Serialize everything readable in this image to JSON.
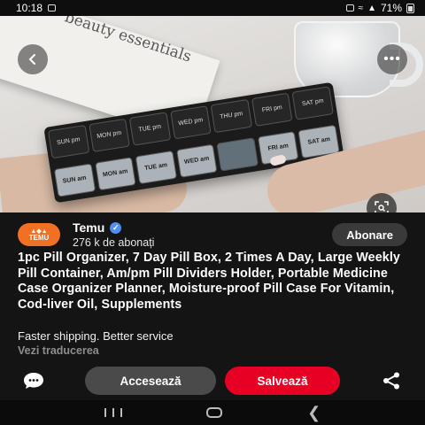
{
  "status_bar": {
    "time": "10:18",
    "battery": "71%"
  },
  "image": {
    "book_text": "beauty essentials",
    "organizer": {
      "pm_labels": [
        "SUN pm",
        "MON pm",
        "TUE pm",
        "WED pm",
        "THU pm",
        "FRI pm",
        "SAT pm"
      ],
      "am_labels": [
        "SUN am",
        "MON am",
        "TUE am",
        "WED am",
        "",
        "FRI am",
        "SAT am"
      ]
    }
  },
  "creator": {
    "avatar_text": "TEMU",
    "name": "Temu",
    "followers": "276 k de abonați",
    "subscribe_label": "Abonare"
  },
  "pin": {
    "title": "1pc Pill Organizer, 7 Day Pill Box, 2 Times A Day, Large Weekly Pill Container, Am/pm Pill Dividers Holder, Portable Medicine Case Organizer Planner, Moisture-proof Pill Case For Vitamin, Cod-liver Oil, Supplements",
    "subtitle": "Faster shipping. Better service",
    "translate_label": "Vezi traducerea"
  },
  "actions": {
    "access_label": "Accesează",
    "save_label": "Salvează"
  },
  "colors": {
    "save_red": "#e60023",
    "temu_orange": "#f36f21",
    "verified_blue": "#4e8ff7"
  },
  "icons": [
    "back-icon",
    "more-icon",
    "lens-search-icon",
    "verified-icon",
    "comment-icon",
    "share-icon"
  ]
}
